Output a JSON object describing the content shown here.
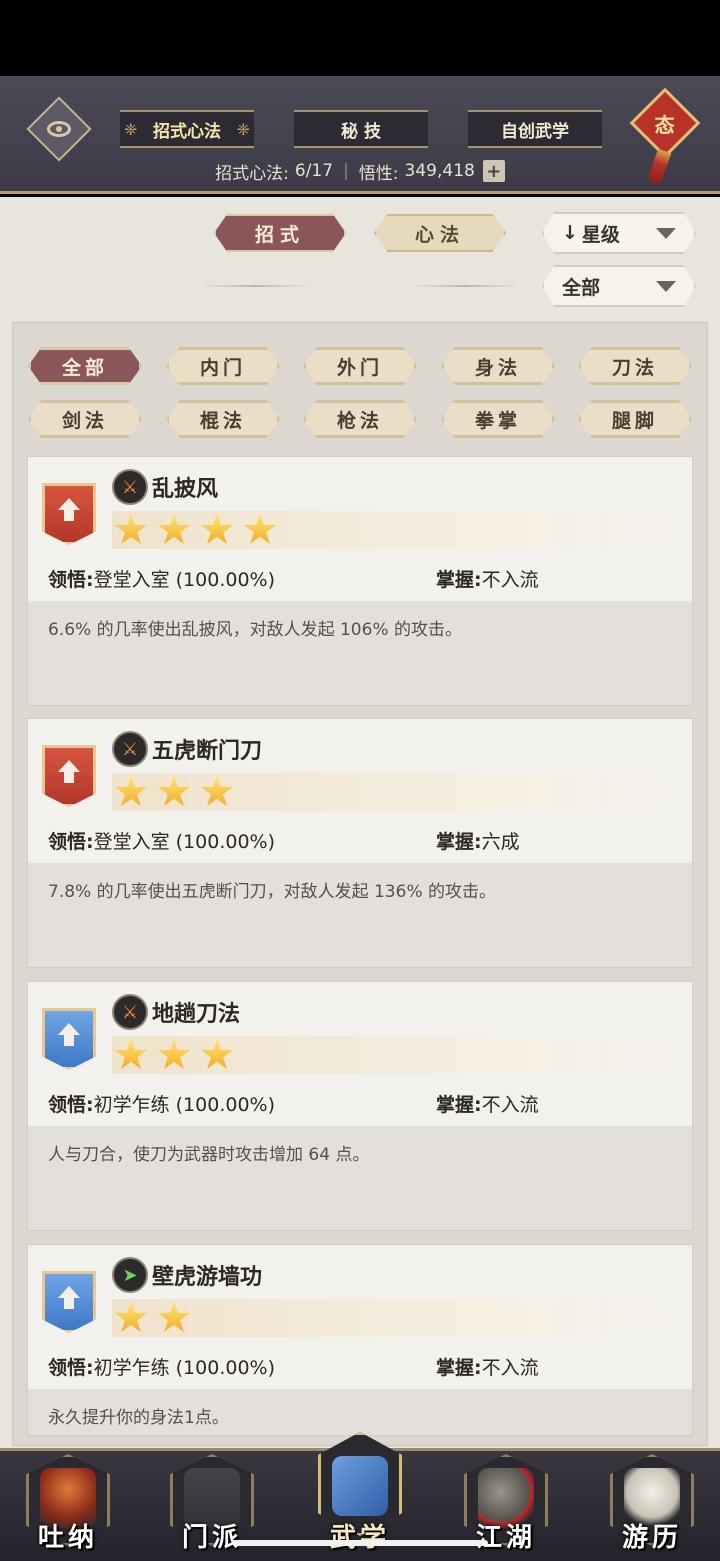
{
  "header": {
    "tabs": [
      {
        "label": "招式心法",
        "active": true
      },
      {
        "label": "秘 技",
        "active": false
      },
      {
        "label": "自创武学",
        "active": false
      }
    ],
    "stat_label": "招式心法:",
    "stat_value": "6/17",
    "insight_label": "悟性:",
    "insight_value": "349,418",
    "plus": "+",
    "talisman_char": "态"
  },
  "mode_tabs": [
    {
      "label": "招式",
      "active": true
    },
    {
      "label": "心法",
      "active": false
    }
  ],
  "sort": {
    "arrow": "↓",
    "label": "星级"
  },
  "filter_dropdown": {
    "label": "全部"
  },
  "filters": [
    {
      "label": "全部",
      "active": true
    },
    {
      "label": "内门",
      "active": false
    },
    {
      "label": "外门",
      "active": false
    },
    {
      "label": "身法",
      "active": false
    },
    {
      "label": "刀法",
      "active": false
    },
    {
      "label": "剑法",
      "active": false
    },
    {
      "label": "棍法",
      "active": false
    },
    {
      "label": "枪法",
      "active": false
    },
    {
      "label": "拳掌",
      "active": false
    },
    {
      "label": "腿脚",
      "active": false
    }
  ],
  "skills": [
    {
      "name": "乱披风",
      "badge_color": "red",
      "icon": "blade-skill-icon",
      "stars": 4,
      "comprehension_label": "领悟:",
      "comprehension_value": "登堂入室 (100.00%)",
      "mastery_label": "掌握:",
      "mastery_value": "不入流",
      "description": "6.6% 的几率使出乱披风，对敌人发起 106% 的攻击。"
    },
    {
      "name": "五虎断门刀",
      "badge_color": "red",
      "icon": "blade-skill-icon",
      "stars": 3,
      "comprehension_label": "领悟:",
      "comprehension_value": "登堂入室 (100.00%)",
      "mastery_label": "掌握:",
      "mastery_value": "六成",
      "description": "7.8% 的几率使出五虎断门刀，对敌人发起 136% 的攻击。"
    },
    {
      "name": "地趟刀法",
      "badge_color": "blue",
      "icon": "blade-skill-icon",
      "stars": 3,
      "comprehension_label": "领悟:",
      "comprehension_value": "初学乍练 (100.00%)",
      "mastery_label": "掌握:",
      "mastery_value": "不入流",
      "description": "人与刀合，使刀为武器时攻击增加 64 点。"
    },
    {
      "name": "壁虎游墙功",
      "badge_color": "blue",
      "icon": "boot-skill-icon",
      "stars": 2,
      "comprehension_label": "领悟:",
      "comprehension_value": "初学乍练 (100.00%)",
      "mastery_label": "掌握:",
      "mastery_value": "不入流",
      "description": "永久提升你的身法1点。"
    }
  ],
  "bottom_nav": [
    {
      "label": "吐纳",
      "active": false
    },
    {
      "label": "门派",
      "active": false
    },
    {
      "label": "武学",
      "active": true
    },
    {
      "label": "江湖",
      "active": false
    },
    {
      "label": "游历",
      "active": false
    }
  ],
  "colors": {
    "accent": "#8a5659",
    "gold": "#f1a81d",
    "badge_red": "#c44a38",
    "badge_blue": "#4f86d2"
  }
}
